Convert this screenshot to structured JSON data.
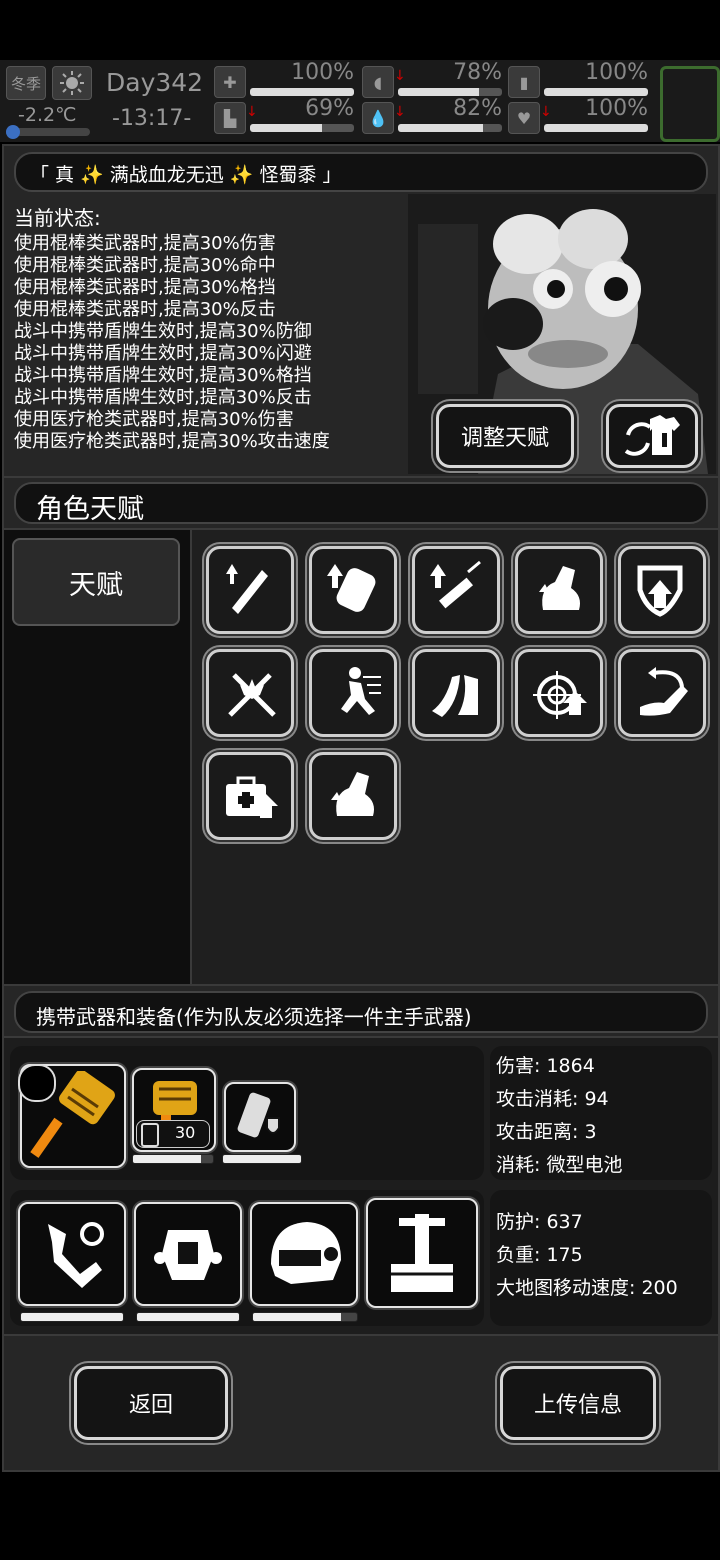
{
  "status": {
    "season": "冬季",
    "weather_icon": "sun-icon",
    "temperature": "-2.2℃",
    "day": "Day342",
    "time": "-13:17-",
    "stats": [
      {
        "icon": "medkit-icon",
        "value": "100%",
        "fill": 1.0,
        "arrow": false
      },
      {
        "icon": "stomach-icon",
        "value": "78%",
        "fill": 0.78,
        "arrow": true
      },
      {
        "icon": "battery-icon",
        "value": "100%",
        "fill": 1.0,
        "arrow": false
      },
      {
        "icon": "boot-icon",
        "value": "69%",
        "fill": 0.69,
        "arrow": true
      },
      {
        "icon": "water-drop-icon",
        "value": "82%",
        "fill": 0.82,
        "arrow": true
      },
      {
        "icon": "heart-icon",
        "value": "100%",
        "fill": 1.0,
        "arrow": true
      }
    ]
  },
  "character": {
    "name": "「 真 ✨ 满战血龙无迅 ✨ 怪蜀黍 」",
    "status_heading": "当前状态:",
    "status_lines": [
      "使用棍棒类武器时,提高30%伤害",
      "使用棍棒类武器时,提高30%命中",
      "使用棍棒类武器时,提高30%格挡",
      "使用棍棒类武器时,提高30%反击",
      "战斗中携带盾牌生效时,提高30%防御",
      "战斗中携带盾牌生效时,提高30%闪避",
      "战斗中携带盾牌生效时,提高30%格挡",
      "战斗中携带盾牌生效时,提高30%反击",
      "使用医疗枪类武器时,提高30%伤害",
      "使用医疗枪类武器时,提高30%攻击速度"
    ],
    "adjust_talent_label": "调整天赋",
    "outfit_button_icon": "shirt-swap-icon"
  },
  "talents": {
    "section_title": "角色天赋",
    "tab_label": "天赋",
    "items": [
      {
        "icon": "club-up-icon"
      },
      {
        "icon": "shield-up-icon"
      },
      {
        "icon": "syringe-up-icon"
      },
      {
        "icon": "arm-strength-icon"
      },
      {
        "icon": "shield-arrow-icon"
      },
      {
        "icon": "crossed-burst-icon"
      },
      {
        "icon": "dash-dodge-icon"
      },
      {
        "icon": "parry-icon"
      },
      {
        "icon": "target-up-icon"
      },
      {
        "icon": "counter-arm-icon"
      },
      {
        "icon": "medkit-up-icon"
      },
      {
        "icon": "arm-flex-icon"
      }
    ]
  },
  "equipment": {
    "section_title": "携带武器和装备(作为队友必须选择一件主手武器)",
    "weapon_stats": [
      "伤害: 1864",
      "攻击消耗: 94",
      "攻击距离: 3",
      "消耗: 微型电池"
    ],
    "armor_stats": [
      "防护: 637",
      "负重: 175",
      "大地图移动速度: 200"
    ],
    "ammo_count": "30",
    "weapons": [
      {
        "icon": "golden-hammer-icon",
        "durability": null
      },
      {
        "icon": "golden-gauntlet-icon",
        "durability": 0.85
      },
      {
        "icon": "shield-gadget-icon",
        "durability": 1.0
      }
    ],
    "armor": [
      {
        "icon": "robot-arm-icon",
        "durability": 1.0
      },
      {
        "icon": "chest-armor-icon",
        "durability": 1.0
      },
      {
        "icon": "helmet-icon",
        "durability": 0.85
      },
      {
        "icon": "exo-legs-icon",
        "durability": null
      }
    ]
  },
  "actions": {
    "back_label": "返回",
    "upload_label": "上传信息"
  }
}
